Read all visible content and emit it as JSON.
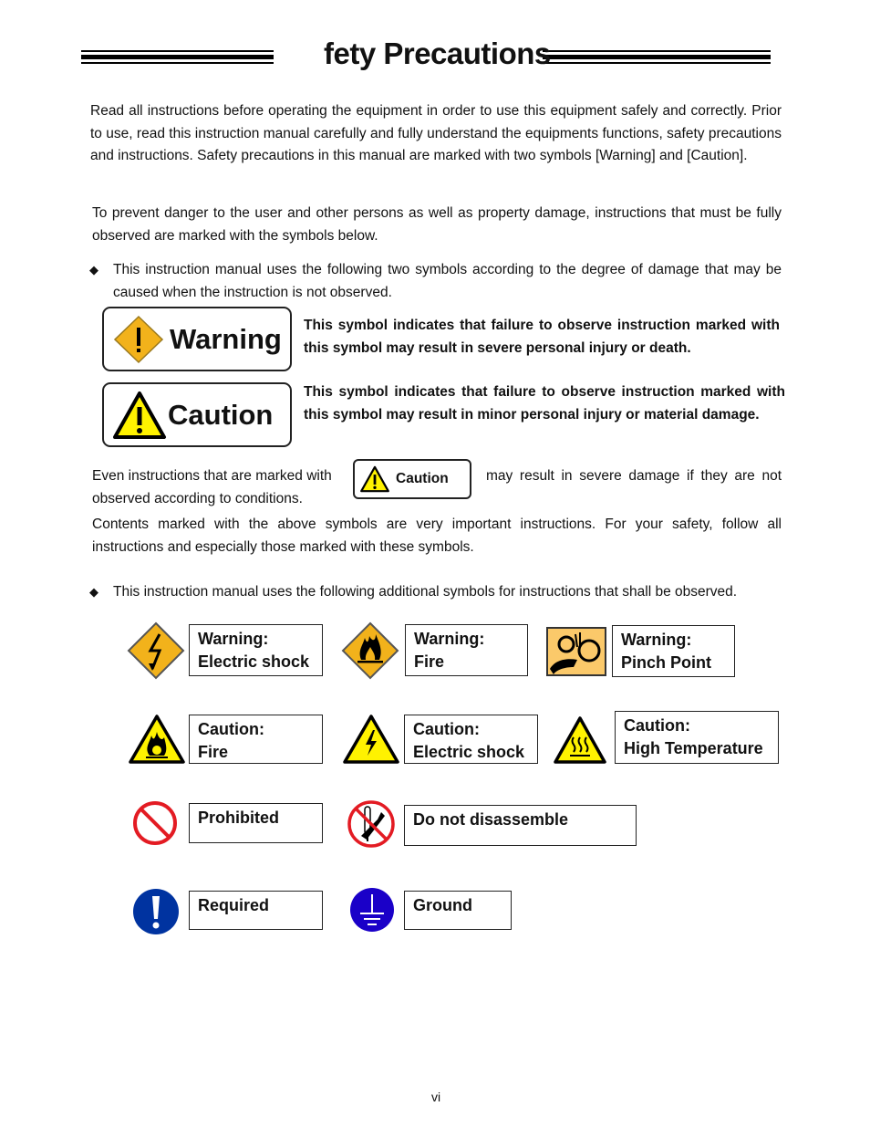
{
  "header": {
    "title": "fety Precautions"
  },
  "intro": {
    "p1": "Read all instructions before operating the equipment in order to use this equipment safely and correctly. Prior to use, read this instruction manual carefully and fully understand the equipments functions, safety precautions and instructions. Safety precautions in this manual are marked with two symbols [Warning] and [Caution].",
    "p2": "To prevent danger to the user and other persons as well as property damage, instructions that must be fully observed are marked with the symbols below.",
    "bullet1": "This instruction manual uses the following two symbols according to the degree of damage that may be caused when the instruction is not observed."
  },
  "signals": {
    "warning": {
      "label": "Warning",
      "icon": "warning-diamond-icon",
      "description": "This symbol indicates that failure to observe instruction marked with this symbol may result in severe personal injury or death."
    },
    "caution": {
      "label": "Caution",
      "icon": "caution-triangle-icon",
      "description": "This symbol indicates that failure to observe instruction marked with this symbol may result in minor personal injury or material damage."
    }
  },
  "even": {
    "before": "Even instructions that are marked with",
    "badge": "Caution",
    "after": "may result in severe damage if they are not observed according to conditions.",
    "p_contents": "Contents marked with the above symbols are very important instructions. For your safety, follow all instructions and especially those marked with these symbols."
  },
  "bullet2": "This instruction manual uses the following additional symbols for instructions that shall be observed.",
  "symbols": [
    {
      "line1": "Warning:",
      "line2": "Electric shock",
      "icon": "warning-electric-shock-icon"
    },
    {
      "line1": "Warning:",
      "line2": "Fire",
      "icon": "warning-fire-icon"
    },
    {
      "line1": "Warning:",
      "line2": "Pinch Point",
      "icon": "warning-pinch-point-icon"
    },
    {
      "line1": "Caution:",
      "line2": "Fire",
      "icon": "caution-fire-icon"
    },
    {
      "line1": "Caution:",
      "line2": "Electric shock",
      "icon": "caution-electric-shock-icon"
    },
    {
      "line1": "Caution:",
      "line2": "High Temperature",
      "icon": "caution-high-temperature-icon"
    },
    {
      "line1": "Prohibited",
      "line2": "",
      "icon": "prohibited-icon"
    },
    {
      "line1": "Do not disassemble",
      "line2": "",
      "icon": "do-not-disassemble-icon"
    },
    {
      "line1": "Required",
      "line2": "",
      "icon": "required-icon"
    },
    {
      "line1": "Ground",
      "line2": "",
      "icon": "ground-icon"
    }
  ],
  "colors": {
    "warning_orange": "#F2B21B",
    "caution_yellow": "#FFF200",
    "prohibited_red": "#E31B23",
    "mandatory_blue": "#0033A0",
    "ground_blue": "#1A00C8"
  },
  "footer": {
    "page_number": "vi"
  }
}
